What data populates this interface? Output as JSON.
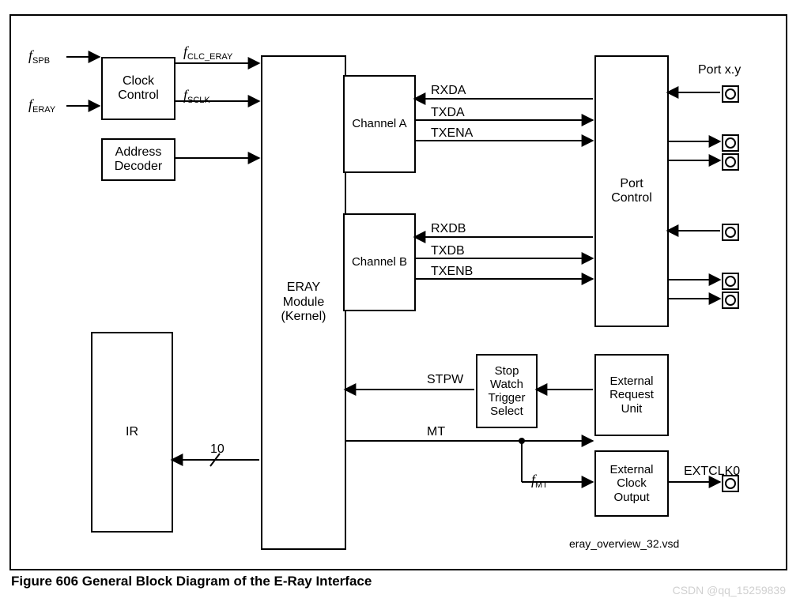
{
  "caption": "Figure 606  General Block Diagram of the E-Ray Interface",
  "watermark": "CSDN @qq_15259839",
  "file_note": "eray_overview_32.vsd",
  "inputs": {
    "f_spb": {
      "sym": "f",
      "sub": "SPB"
    },
    "f_eray": {
      "sym": "f",
      "sub": "ERAY"
    }
  },
  "clock_outputs": {
    "f_clc_eray": {
      "sym": "f",
      "sub": "CLC_ERAY"
    },
    "f_sclk": {
      "sym": "f",
      "sub": "SCLK"
    }
  },
  "blocks": {
    "clock_control": "Clock\nControl",
    "address_decoder": "Address\nDecoder",
    "eray_module": "ERAY\nModule\n(Kernel)",
    "channel_a": "Channel A",
    "channel_b": "Channel B",
    "ir": "IR",
    "stop_watch": "Stop\nWatch\nTrigger\nSelect",
    "port_control": "Port\nControl",
    "ext_req_unit": "External\nRequest\nUnit",
    "ext_clock_out": "External\nClock\nOutput"
  },
  "signals": {
    "rxda": "RXDA",
    "txda": "TXDA",
    "txena": "TXENA",
    "rxdb": "RXDB",
    "txdb": "TXDB",
    "txenb": "TXENB",
    "stpw": "STPW",
    "mt": "MT",
    "f_mt": {
      "sym": "f",
      "sub": "MT"
    },
    "ir_bus": "10",
    "port_xy": "Port x.y",
    "extclk0": "EXTCLK0"
  }
}
